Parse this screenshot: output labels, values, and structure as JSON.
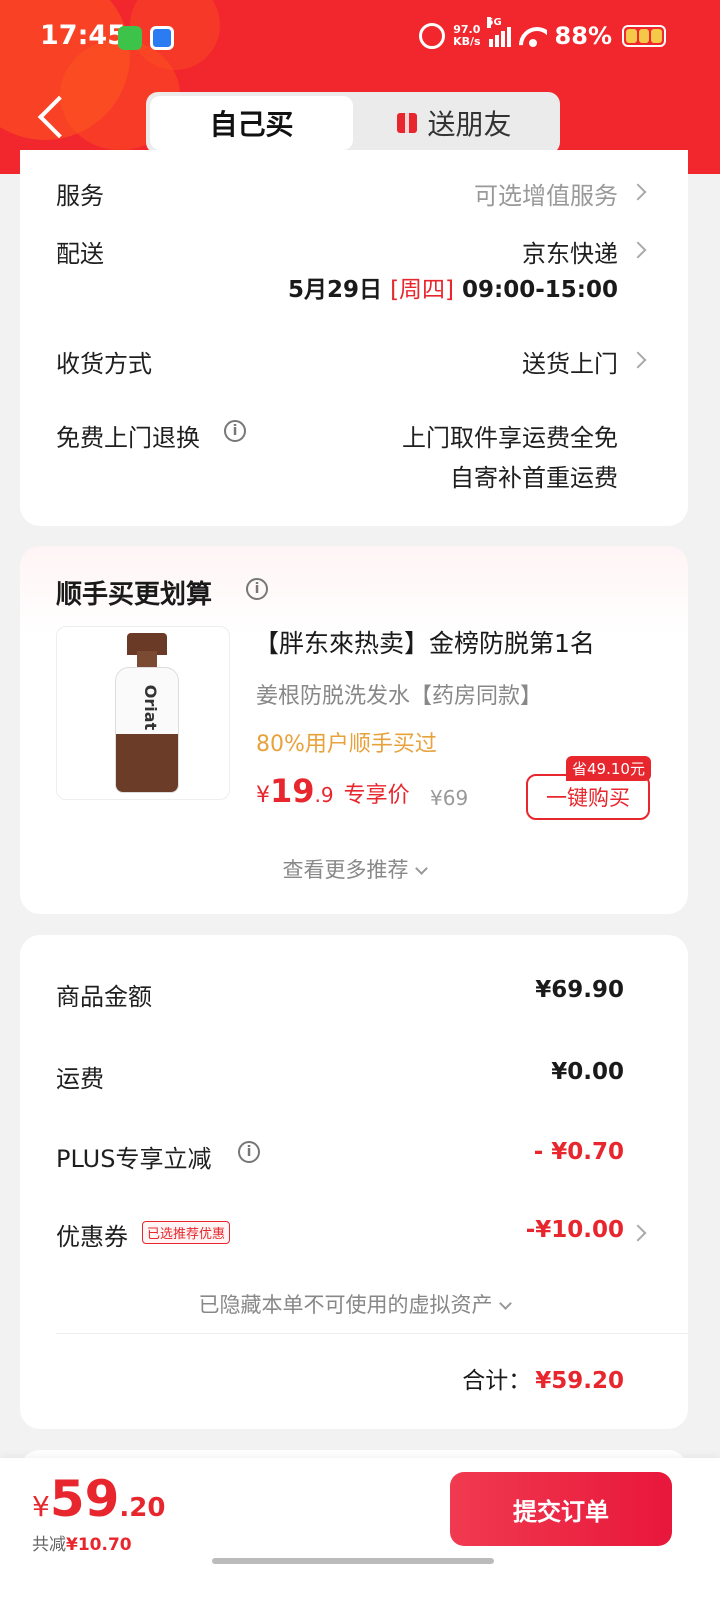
{
  "status_bar": {
    "time": "17:45",
    "net_speed_value": "97.0",
    "net_speed_unit": "KB/s",
    "signal_label": "5G",
    "battery": "88%"
  },
  "header": {
    "tab_self": "自己买",
    "tab_gift": "送朋友"
  },
  "delivery": {
    "service_label": "服务",
    "service_value": "可选增值服务",
    "shipping_label": "配送",
    "shipping_value": "京东快递",
    "date": "5月29日",
    "weekday": "[周四]",
    "time_window": "09:00-15:00",
    "receive_label": "收货方式",
    "receive_value": "送货上门",
    "return_label": "免费上门退换",
    "return_line1": "上门取件享运费全免",
    "return_line2": "自寄补首重运费"
  },
  "recommend": {
    "title": "顺手买更划算",
    "product_title": "【胖东來热卖】金榜防脱第1名",
    "product_subtitle": "姜根防脱洗发水【药房同款】",
    "social_proof": "80%用户顺手买过",
    "price_currency": "¥",
    "price_int": "19",
    "price_dec": ".9",
    "price_tag": "专享价",
    "original_price": "¥69",
    "save_badge": "省49.10元",
    "buy_button": "一键购买",
    "more_link": "查看更多推荐",
    "bottle_brand": "Oriat"
  },
  "summary": {
    "goods_label": "商品金额",
    "goods_value": "¥69.90",
    "freight_label": "运费",
    "freight_value": "¥0.00",
    "plus_label": "PLUS专享立减",
    "plus_value": "- ¥0.70",
    "coupon_label": "优惠券",
    "coupon_badge": "已选推荐优惠",
    "coupon_value": "-¥10.00",
    "hidden_assets": "已隐藏本单不可使用的虚拟资产",
    "total_label": "合计：",
    "total_value": "¥59.20"
  },
  "bottom_bar": {
    "currency": "¥",
    "price_int": "59",
    "price_dec": ".20",
    "saved_label": "共减",
    "saved_value": "¥10.70",
    "submit_label": "提交订单"
  },
  "colors": {
    "brand_red": "#f2272d",
    "price_red": "#e8262d",
    "accent_orange": "#e8a23c"
  }
}
